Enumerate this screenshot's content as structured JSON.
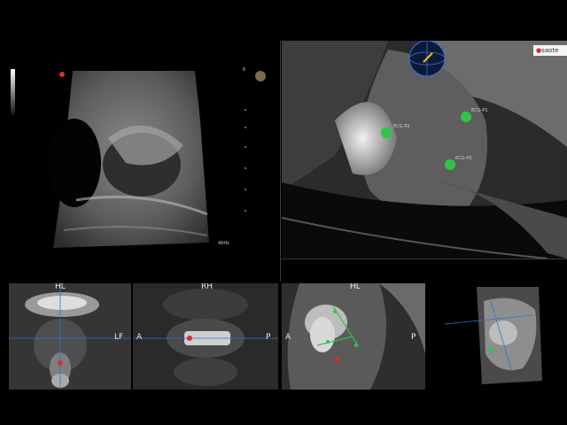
{
  "ultrasound": {
    "freq": "40Hz",
    "depth_marker": "6"
  },
  "mri_main": {
    "brand": "saote",
    "markers": [
      {
        "label": "ECG-P2"
      },
      {
        "label": "ECG-P1"
      },
      {
        "label": "ECG-P3"
      }
    ]
  },
  "views": {
    "coronal": {
      "top": "HL",
      "right": "LF"
    },
    "axial": {
      "top": "RH",
      "left": "A",
      "right": "P"
    },
    "sagittal": {
      "top": "HL",
      "left": "A",
      "right": "P"
    }
  },
  "colors": {
    "marker_green": "#2ec44a",
    "crosshair_blue": "#3a6fd0",
    "accent_red": "#d23030"
  }
}
